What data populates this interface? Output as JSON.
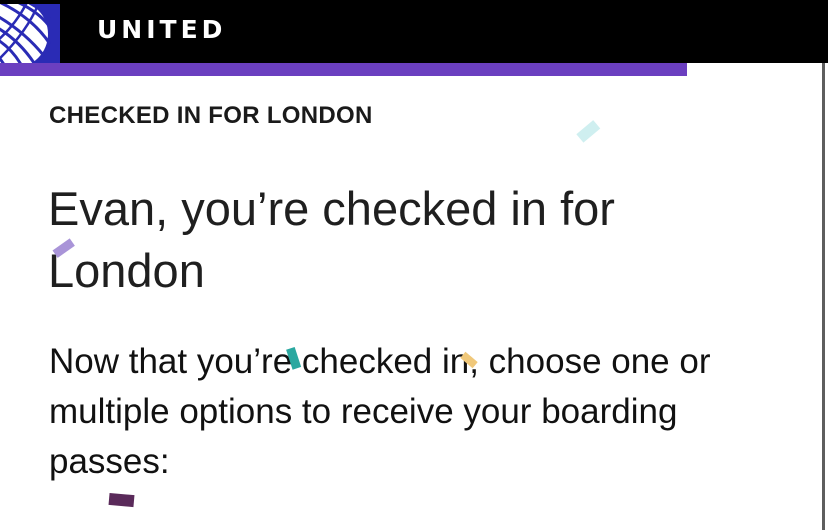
{
  "header": {
    "brand": "UNITED",
    "logo_icon": "globe-icon",
    "background_color": "#000000",
    "logo_color": "#2a2bb5"
  },
  "progress": {
    "fraction": 0.83,
    "color": "#6b3fc0"
  },
  "main": {
    "eyebrow": "CHECKED IN FOR LONDON",
    "headline": "Evan, you’re checked in for London",
    "body": "Now that you’re checked in, choose one or multiple options to receive your boarding passes:"
  },
  "confetti_colors": [
    "#cfeff0",
    "#a994d8",
    "#2aa8a0",
    "#f0c87a",
    "#5a2a5a"
  ]
}
